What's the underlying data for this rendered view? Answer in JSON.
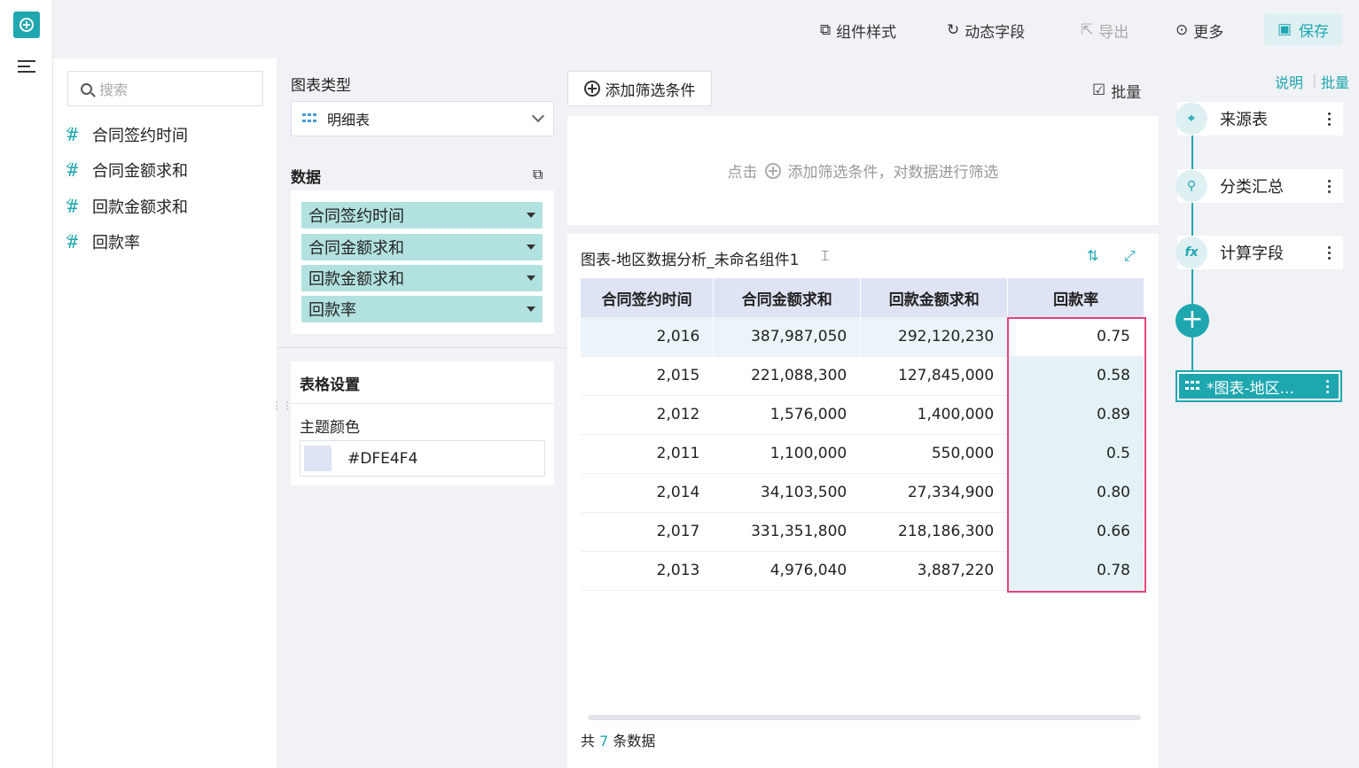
{
  "toolbar": {
    "component_style": "组件样式",
    "dynamic_field": "动态字段",
    "export": "导出",
    "more": "更多",
    "save": "保存"
  },
  "fields": {
    "search_placeholder": "搜索",
    "items": [
      "合同签约时间",
      "合同金额求和",
      "回款金额求和",
      "回款率"
    ]
  },
  "config": {
    "chart_type_label": "图表类型",
    "chart_type_value": "明细表",
    "data_label": "数据",
    "data_items": [
      "合同签约时间",
      "合同金额求和",
      "回款金额求和",
      "回款率"
    ],
    "table_settings": "表格设置",
    "theme_color_label": "主题颜色",
    "theme_color_value": "#DFE4F4"
  },
  "filter": {
    "add_button": "添加筛选条件",
    "batch": "批量",
    "hint_prefix": "点击",
    "hint_suffix": "添加筛选条件，对数据进行筛选"
  },
  "chart": {
    "title": "图表-地区数据分析_未命名组件1",
    "headers": [
      "合同签约时间",
      "合同金额求和",
      "回款金额求和",
      "回款率"
    ],
    "rows": [
      [
        "2,016",
        "387,987,050",
        "292,120,230",
        "0.75"
      ],
      [
        "2,015",
        "221,088,300",
        "127,845,000",
        "0.58"
      ],
      [
        "2,012",
        "1,576,000",
        "1,400,000",
        "0.89"
      ],
      [
        "2,011",
        "1,100,000",
        "550,000",
        "0.5"
      ],
      [
        "2,014",
        "34,103,500",
        "27,334,900",
        "0.80"
      ],
      [
        "2,017",
        "331,351,800",
        "218,186,300",
        "0.66"
      ],
      [
        "2,013",
        "4,976,040",
        "3,887,220",
        "0.78"
      ]
    ],
    "footer_prefix": "共",
    "footer_count": "7",
    "footer_suffix": "条数据"
  },
  "pipeline": {
    "explain": "说明",
    "batch": "批量",
    "steps": [
      "来源表",
      "分类汇总",
      "计算字段"
    ],
    "step_icons": [
      "⌖",
      "⚲",
      "fx"
    ],
    "active": "*图表-地区..."
  },
  "colors": {
    "accent": "#1fa7b0",
    "header": "#dfe4f4",
    "highlight": "#e0457b"
  }
}
